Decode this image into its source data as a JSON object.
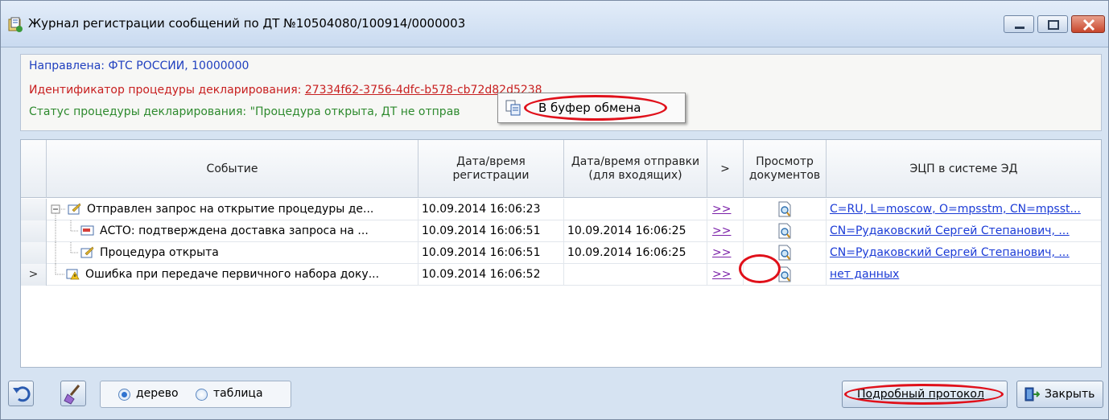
{
  "window": {
    "title": "Журнал регистрации сообщений по ДТ №10504080/100914/0000003"
  },
  "info": {
    "directed": "Направлена: ФТС РОССИИ, 10000000",
    "procedure_id_label": "Идентификатор процедуры декларирования: ",
    "procedure_id_value": "27334f62-3756-4dfc-b578-cb72d82d5238",
    "status": "Статус процедуры декларирования: \"Процедура открыта, ДТ не отправ"
  },
  "context_menu": {
    "copy_label": "В буфер обмена"
  },
  "table": {
    "headers": {
      "event": "Событие",
      "reg_date": "Дата/время регистрации",
      "send_date": "Дата/время отправки (для входящих)",
      "arrow": ">",
      "view_docs": "Просмотр документов",
      "ecp": "ЭЦП в системе ЭД"
    },
    "rows": [
      {
        "event": "Отправлен запрос на открытие процедуры де...",
        "reg_date": "10.09.2014 16:06:23",
        "send_date": "",
        "arrow": ">>",
        "ecp": "C=RU, L=moscow, O=mpsstm, CN=mpsst...",
        "marker": ""
      },
      {
        "event": "АСТО: подтверждена доставка запроса на ...",
        "reg_date": "10.09.2014 16:06:51",
        "send_date": "10.09.2014 16:06:25",
        "arrow": ">>",
        "ecp": "CN=Рудаковский Сергей Степанович, ...",
        "marker": ""
      },
      {
        "event": "Процедура открыта",
        "reg_date": "10.09.2014 16:06:51",
        "send_date": "10.09.2014 16:06:25",
        "arrow": ">>",
        "ecp": "CN=Рудаковский Сергей Степанович, ...",
        "marker": ""
      },
      {
        "event": "Ошибка при передаче первичного набора доку...",
        "reg_date": "10.09.2014 16:06:52",
        "send_date": "",
        "arrow": ">>",
        "ecp": "нет данных",
        "marker": ">"
      }
    ]
  },
  "toolbar": {
    "view_mode_tree": "дерево",
    "view_mode_table": "таблица",
    "view_mode_selected": "дерево",
    "protocol_button": "Подробный протокол",
    "close_button": "Закрыть"
  },
  "colors": {
    "link": "#1b3bd6",
    "highlight_oval": "#e0101a",
    "info_blue": "#1f3fbf",
    "info_red": "#c82020",
    "info_green": "#2e8a2e"
  }
}
